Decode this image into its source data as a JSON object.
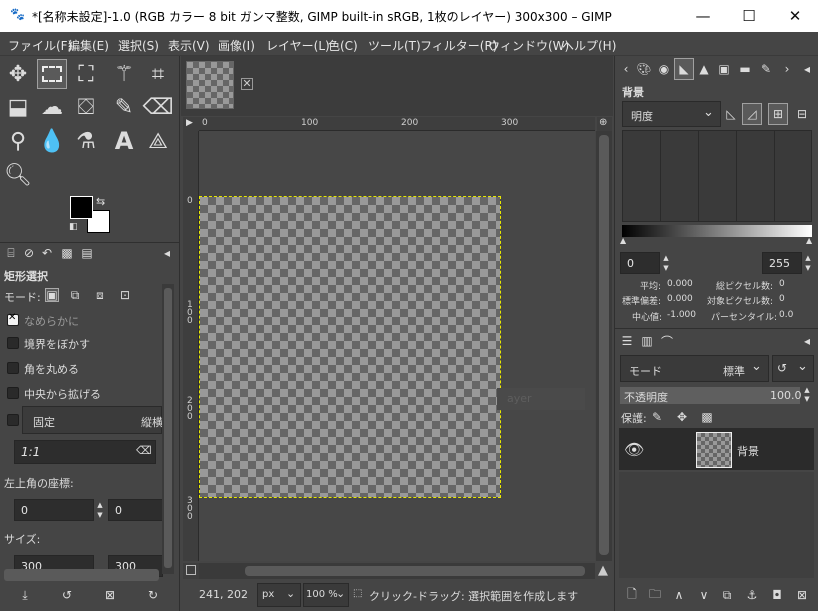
{
  "window": {
    "title": "*[名称未設定]-1.0 (RGB カラー 8 bit ガンマ整数, GIMP built-in sRGB, 1枚のレイヤー) 300x300 – GIMP",
    "minimize": "—",
    "maximize": "☐",
    "close": "✕"
  },
  "menu": [
    "ファイル(F)",
    "編集(E)",
    "選択(S)",
    "表示(V)",
    "画像(I)",
    "レイヤー(L)",
    "色(C)",
    "ツール(T)",
    "フィルター(R)",
    "ウィンドウ(W)",
    "ヘルプ(H)"
  ],
  "toolbox": {
    "tools_row1": [
      "move-tool",
      "rect-select-tool",
      "free-select-tool",
      "fuzzy-select-tool",
      "crop-tool"
    ],
    "tools_row2": [
      "transform-tool",
      "warp-tool",
      "bucket-fill-tool",
      "paintbrush-tool",
      "eraser-tool"
    ],
    "tools_row3": [
      "clone-tool",
      "smudge-tool",
      "dodge-tool",
      "text-tool",
      "path-tool"
    ],
    "tools_row4": [
      "zoom-tool"
    ]
  },
  "tool_options": {
    "title": "矩形選択",
    "mode_label": "モード:",
    "antialias_label": "なめらかに",
    "feather_label": "境界をぼかす",
    "rounded_label": "角を丸める",
    "expand_label": "中央から拡げる",
    "fixed_label": "固定",
    "fixed_value": "縦横",
    "ratio_value": "1:1",
    "position_label": "左上角の座標:",
    "pos_x": "0",
    "pos_y": "0",
    "size_label": "サイズ:",
    "size_w": "300",
    "size_h": "300"
  },
  "canvas": {
    "ruler_top": [
      "0",
      "100",
      "200",
      "300"
    ],
    "ruler_left": [
      "0",
      "1\n0\n0",
      "2\n0\n0",
      "3\n0\n0"
    ],
    "ghost_text": "ayer"
  },
  "status": {
    "coords": "241, 202",
    "unit": "px",
    "zoom": "100 %",
    "message": "クリック-ドラッグ: 選択範囲を作成します"
  },
  "histogram": {
    "title": "背景",
    "channel": "明度",
    "range_min": "0",
    "range_max": "255",
    "stats": {
      "mean_label": "平均:",
      "mean": "0.000",
      "stddev_label": "標準偏差:",
      "stddev": "0.000",
      "median_label": "中心値:",
      "median": "-1.000",
      "pixels_label": "総ピクセル数:",
      "pixels": "0",
      "count_label": "対象ピクセル数:",
      "count": "0",
      "percentile_label": "パーセンタイル:",
      "percentile": "0.0"
    }
  },
  "layers": {
    "mode_label": "モード",
    "mode_value": "標準",
    "opacity_label": "不透明度",
    "opacity_value": "100.0",
    "lock_label": "保護:",
    "layer_name": "背景"
  }
}
